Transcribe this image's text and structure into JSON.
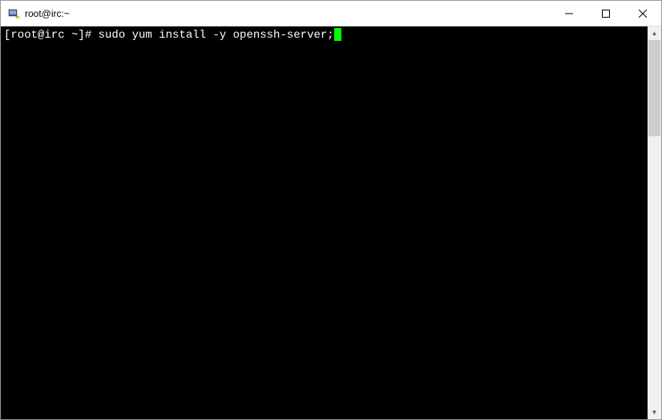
{
  "window": {
    "title": "root@irc:~",
    "icon_name": "putty-icon"
  },
  "controls": {
    "minimize": "─",
    "maximize": "☐",
    "close": "✕"
  },
  "terminal": {
    "prompt": "[root@irc ~]# ",
    "command": "sudo yum install -y openssh-server;"
  },
  "scrollbar": {
    "up": "▲",
    "down": "▼"
  }
}
